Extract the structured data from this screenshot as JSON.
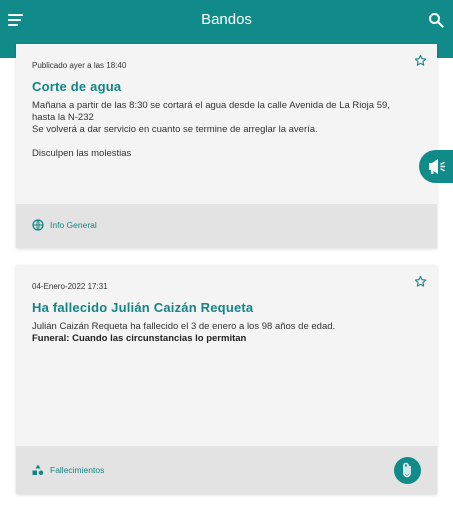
{
  "header": {
    "title": "Bandos"
  },
  "cards": [
    {
      "date": "Publicado ayer a las 18:40",
      "title": "Corte de agua",
      "body": "Mañana a partir de las 8:30 se cortará el agua desde la calle Avenida de La Rioja 59, hasta la N-232\nSe volverá a dar servicio en cuanto se termine de arreglar la avería.\n\n Disculpen las molestias",
      "category": "Info General",
      "category_icon": "globe-icon"
    },
    {
      "date": "04-Enero-2022 17:31",
      "title": "Ha fallecido Julián Caizán Requeta",
      "body": "Julián Caizán Requeta  ha fallecido el 3 de enero a los 98 años de edad.",
      "body_bold": "Funeral:  Cuando las circunstancias lo permitan",
      "category": "Fallecimientos",
      "category_icon": "shapes-icon"
    }
  ],
  "colors": {
    "accent": "#118a8a",
    "title": "#138585"
  }
}
